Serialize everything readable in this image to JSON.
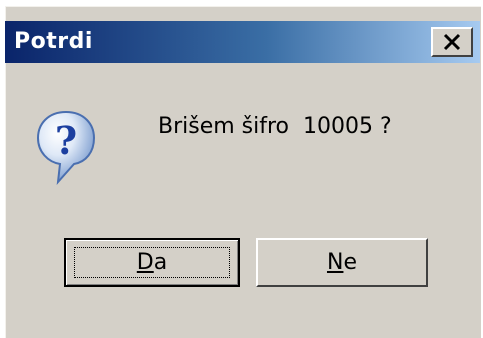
{
  "window": {
    "title": "Potrdi",
    "close_glyph": "✕"
  },
  "dialog": {
    "icon": "question-icon",
    "message": "Brišem šifro  10005 ?"
  },
  "buttons": {
    "yes_accel": "D",
    "yes_rest": "a",
    "no_accel": "N",
    "no_rest": "e"
  },
  "colors": {
    "titlebar_start": "#0a246a",
    "titlebar_end": "#a6caf0",
    "face": "#d4d0c8"
  }
}
